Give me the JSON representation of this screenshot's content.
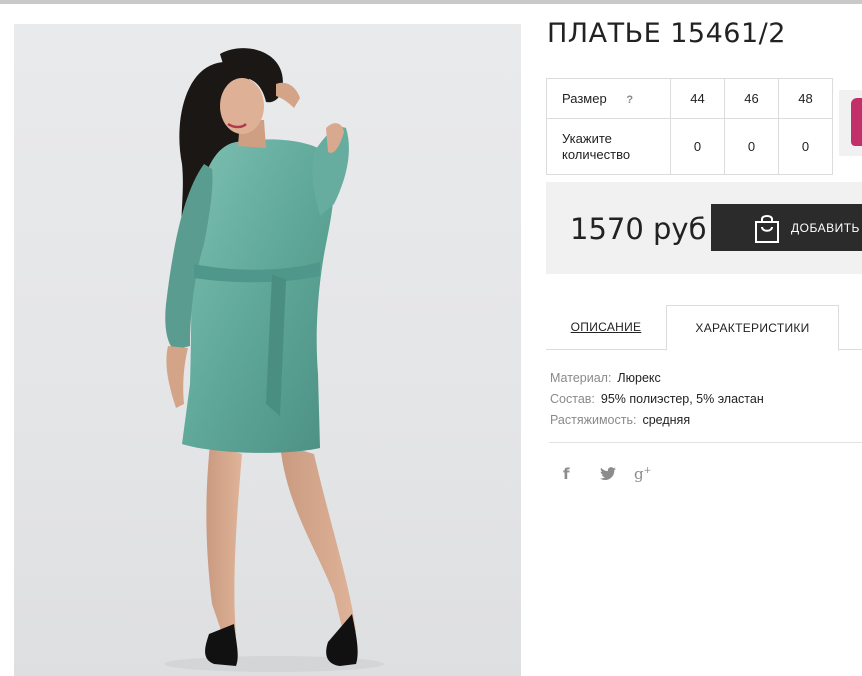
{
  "product": {
    "title": "ПЛАТЬЕ 15461/2",
    "photo_alt": ""
  },
  "size_table": {
    "size_label": "Размер",
    "help_symbol": "?",
    "sizes": [
      "44",
      "46",
      "48"
    ],
    "quantity_label_line1": "Укажите",
    "quantity_label_line2": "количество",
    "quantities": [
      "0",
      "0",
      "0"
    ]
  },
  "purchase": {
    "price": "1570 руб",
    "add_button_label": "ДОБАВИТЬ"
  },
  "tabs": {
    "description": "ОПИСАНИЕ",
    "characteristics": "ХАРАКТЕРИСТИКИ",
    "active": "characteristics"
  },
  "specs": [
    {
      "key": "Материал:",
      "value": "Люрекс"
    },
    {
      "key": "Состав:",
      "value": "95% полиэстер, 5% эластан"
    },
    {
      "key": "Растяжимость:",
      "value": "средняя"
    }
  ],
  "social": {
    "facebook": "f",
    "google_plus": "g",
    "google_plus_sup": "+"
  },
  "colors": {
    "dress": "#5fa89a",
    "button_bg": "#2b2b2b",
    "price_bg": "#f1f1f1"
  }
}
